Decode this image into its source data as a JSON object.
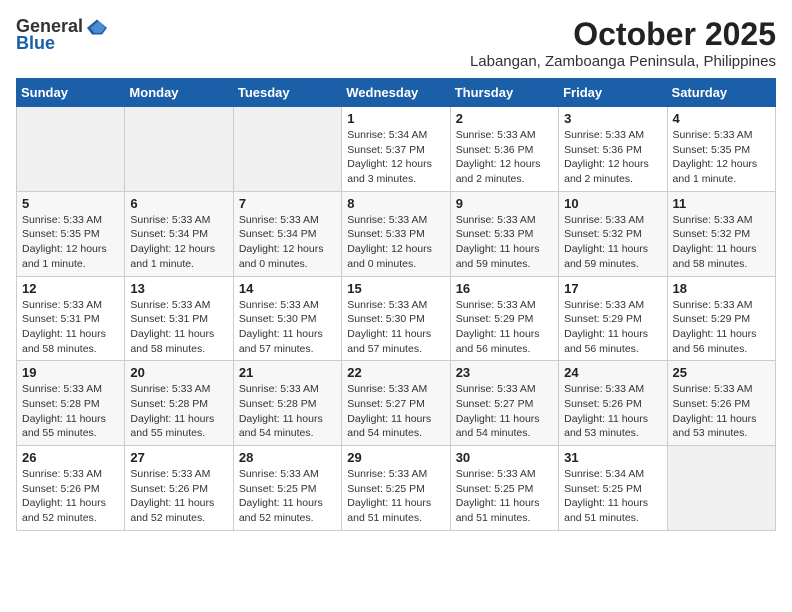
{
  "header": {
    "logo_general": "General",
    "logo_blue": "Blue",
    "month_title": "October 2025",
    "location": "Labangan, Zamboanga Peninsula, Philippines"
  },
  "calendar": {
    "days_of_week": [
      "Sunday",
      "Monday",
      "Tuesday",
      "Wednesday",
      "Thursday",
      "Friday",
      "Saturday"
    ],
    "weeks": [
      [
        {
          "day": "",
          "info": ""
        },
        {
          "day": "",
          "info": ""
        },
        {
          "day": "",
          "info": ""
        },
        {
          "day": "1",
          "info": "Sunrise: 5:34 AM\nSunset: 5:37 PM\nDaylight: 12 hours and 3 minutes."
        },
        {
          "day": "2",
          "info": "Sunrise: 5:33 AM\nSunset: 5:36 PM\nDaylight: 12 hours and 2 minutes."
        },
        {
          "day": "3",
          "info": "Sunrise: 5:33 AM\nSunset: 5:36 PM\nDaylight: 12 hours and 2 minutes."
        },
        {
          "day": "4",
          "info": "Sunrise: 5:33 AM\nSunset: 5:35 PM\nDaylight: 12 hours and 1 minute."
        }
      ],
      [
        {
          "day": "5",
          "info": "Sunrise: 5:33 AM\nSunset: 5:35 PM\nDaylight: 12 hours and 1 minute."
        },
        {
          "day": "6",
          "info": "Sunrise: 5:33 AM\nSunset: 5:34 PM\nDaylight: 12 hours and 1 minute."
        },
        {
          "day": "7",
          "info": "Sunrise: 5:33 AM\nSunset: 5:34 PM\nDaylight: 12 hours and 0 minutes."
        },
        {
          "day": "8",
          "info": "Sunrise: 5:33 AM\nSunset: 5:33 PM\nDaylight: 12 hours and 0 minutes."
        },
        {
          "day": "9",
          "info": "Sunrise: 5:33 AM\nSunset: 5:33 PM\nDaylight: 11 hours and 59 minutes."
        },
        {
          "day": "10",
          "info": "Sunrise: 5:33 AM\nSunset: 5:32 PM\nDaylight: 11 hours and 59 minutes."
        },
        {
          "day": "11",
          "info": "Sunrise: 5:33 AM\nSunset: 5:32 PM\nDaylight: 11 hours and 58 minutes."
        }
      ],
      [
        {
          "day": "12",
          "info": "Sunrise: 5:33 AM\nSunset: 5:31 PM\nDaylight: 11 hours and 58 minutes."
        },
        {
          "day": "13",
          "info": "Sunrise: 5:33 AM\nSunset: 5:31 PM\nDaylight: 11 hours and 58 minutes."
        },
        {
          "day": "14",
          "info": "Sunrise: 5:33 AM\nSunset: 5:30 PM\nDaylight: 11 hours and 57 minutes."
        },
        {
          "day": "15",
          "info": "Sunrise: 5:33 AM\nSunset: 5:30 PM\nDaylight: 11 hours and 57 minutes."
        },
        {
          "day": "16",
          "info": "Sunrise: 5:33 AM\nSunset: 5:29 PM\nDaylight: 11 hours and 56 minutes."
        },
        {
          "day": "17",
          "info": "Sunrise: 5:33 AM\nSunset: 5:29 PM\nDaylight: 11 hours and 56 minutes."
        },
        {
          "day": "18",
          "info": "Sunrise: 5:33 AM\nSunset: 5:29 PM\nDaylight: 11 hours and 56 minutes."
        }
      ],
      [
        {
          "day": "19",
          "info": "Sunrise: 5:33 AM\nSunset: 5:28 PM\nDaylight: 11 hours and 55 minutes."
        },
        {
          "day": "20",
          "info": "Sunrise: 5:33 AM\nSunset: 5:28 PM\nDaylight: 11 hours and 55 minutes."
        },
        {
          "day": "21",
          "info": "Sunrise: 5:33 AM\nSunset: 5:28 PM\nDaylight: 11 hours and 54 minutes."
        },
        {
          "day": "22",
          "info": "Sunrise: 5:33 AM\nSunset: 5:27 PM\nDaylight: 11 hours and 54 minutes."
        },
        {
          "day": "23",
          "info": "Sunrise: 5:33 AM\nSunset: 5:27 PM\nDaylight: 11 hours and 54 minutes."
        },
        {
          "day": "24",
          "info": "Sunrise: 5:33 AM\nSunset: 5:26 PM\nDaylight: 11 hours and 53 minutes."
        },
        {
          "day": "25",
          "info": "Sunrise: 5:33 AM\nSunset: 5:26 PM\nDaylight: 11 hours and 53 minutes."
        }
      ],
      [
        {
          "day": "26",
          "info": "Sunrise: 5:33 AM\nSunset: 5:26 PM\nDaylight: 11 hours and 52 minutes."
        },
        {
          "day": "27",
          "info": "Sunrise: 5:33 AM\nSunset: 5:26 PM\nDaylight: 11 hours and 52 minutes."
        },
        {
          "day": "28",
          "info": "Sunrise: 5:33 AM\nSunset: 5:25 PM\nDaylight: 11 hours and 52 minutes."
        },
        {
          "day": "29",
          "info": "Sunrise: 5:33 AM\nSunset: 5:25 PM\nDaylight: 11 hours and 51 minutes."
        },
        {
          "day": "30",
          "info": "Sunrise: 5:33 AM\nSunset: 5:25 PM\nDaylight: 11 hours and 51 minutes."
        },
        {
          "day": "31",
          "info": "Sunrise: 5:34 AM\nSunset: 5:25 PM\nDaylight: 11 hours and 51 minutes."
        },
        {
          "day": "",
          "info": ""
        }
      ]
    ]
  }
}
